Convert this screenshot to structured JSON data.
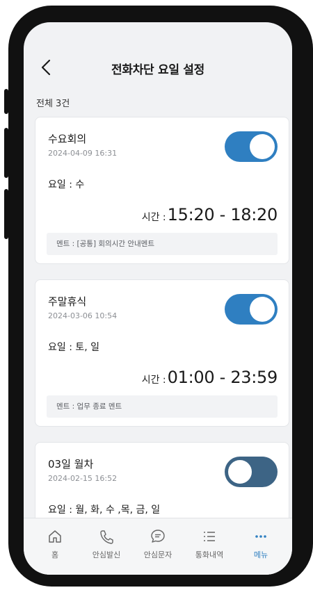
{
  "header": {
    "title": "전화차단 요일 설정",
    "back_icon": "chevron-left-icon"
  },
  "summary": {
    "count_label": "전체 3건"
  },
  "labels": {
    "days_prefix": "요일 : ",
    "time_prefix": "시간 : ",
    "ment_prefix": "멘트 : "
  },
  "cards": [
    {
      "title": "수요회의",
      "date": "2024-04-09 16:31",
      "days": "요일 : 수",
      "time_label": "시간 : ",
      "time": "15:20 - 18:20",
      "ment": "멘트 : [공통] 회의시간 안내멘트",
      "enabled": true
    },
    {
      "title": "주말휴식",
      "date": "2024-03-06 10:54",
      "days": "요일 : 토, 일",
      "time_label": "시간 : ",
      "time": "01:00 - 23:59",
      "ment": "멘트 : 업무 종료 멘트",
      "enabled": true
    },
    {
      "title": "03일 월차",
      "date": "2024-02-15 16:52",
      "days": "요일 : 월, 화, 수 ,목, 금, 일",
      "enabled": false
    }
  ],
  "colors": {
    "accent": "#2f7fc1",
    "toggle_off": "#3d6485",
    "background": "#f1f2f4"
  },
  "bottom_nav": {
    "items": [
      {
        "label": "홈",
        "icon": "home-icon"
      },
      {
        "label": "안심발신",
        "icon": "phone-icon"
      },
      {
        "label": "안심문자",
        "icon": "message-icon"
      },
      {
        "label": "통화내역",
        "icon": "list-icon"
      },
      {
        "label": "메뉴",
        "icon": "more-icon"
      }
    ],
    "active": "메뉴"
  }
}
